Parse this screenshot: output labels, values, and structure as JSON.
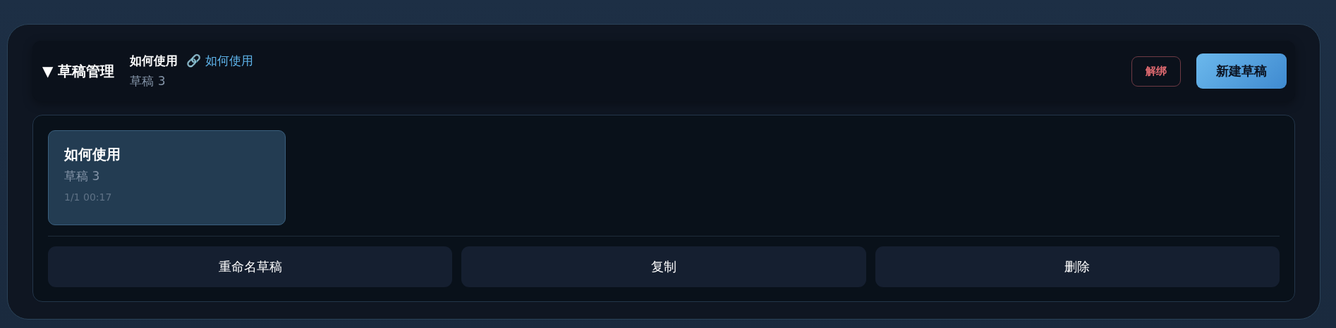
{
  "header": {
    "toggle": "▼",
    "title": "草稿管理",
    "current_draft": {
      "name": "如何使用",
      "link_icon": "🔗",
      "link": "如何使用",
      "subtitle": "草稿 3"
    },
    "buttons": [
      {
        "label": "解绑",
        "kind": "danger"
      },
      {
        "label": "新建草稿",
        "kind": "primary"
      }
    ]
  },
  "drafts": [
    {
      "title": "如何使用",
      "subtitle": "草稿 3",
      "time": "1/1 00:17",
      "selected": true
    }
  ],
  "actions": [
    {
      "label": "重命名草稿"
    },
    {
      "label": "复制"
    },
    {
      "label": "删除"
    }
  ]
}
